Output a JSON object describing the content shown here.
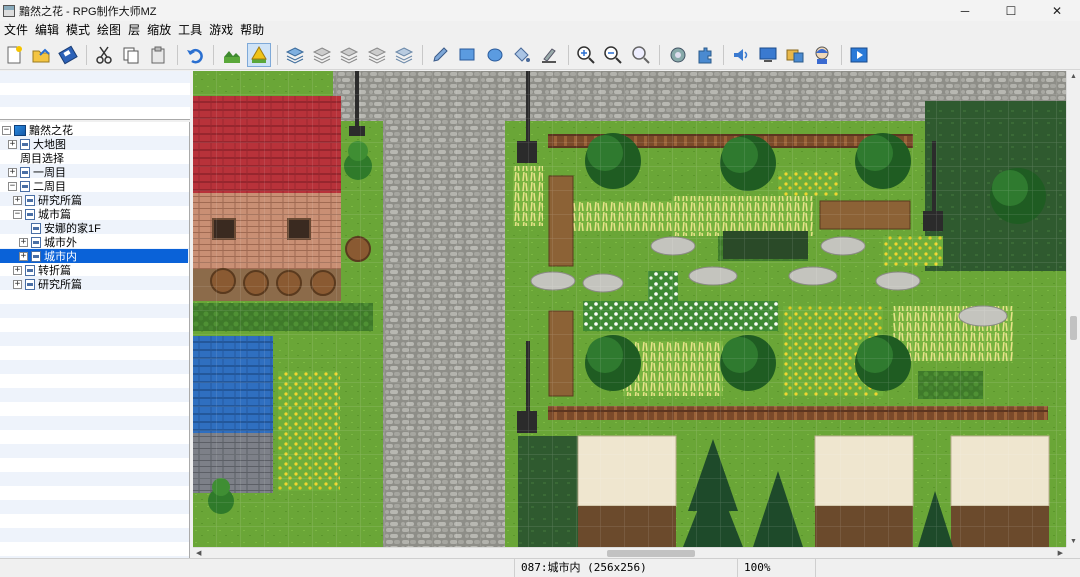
{
  "window": {
    "title": "黯然之花 - RPG制作大师MZ",
    "controls": [
      "─",
      "☐",
      "✕"
    ]
  },
  "menu": [
    "文件",
    "编辑",
    "模式",
    "绘图",
    "层",
    "缩放",
    "工具",
    "游戏",
    "帮助"
  ],
  "toolbar": {
    "buttons": [
      {
        "name": "new-project-icon"
      },
      {
        "name": "open-project-icon"
      },
      {
        "name": "save-project-icon"
      },
      {
        "name": "cut-icon"
      },
      {
        "name": "copy-icon"
      },
      {
        "name": "paste-icon"
      },
      {
        "name": "undo-icon"
      },
      {
        "name": "map-mode-icon"
      },
      {
        "name": "event-mode-icon",
        "active": true
      },
      {
        "name": "layer-auto-icon"
      },
      {
        "name": "layer-1-icon"
      },
      {
        "name": "layer-2-icon"
      },
      {
        "name": "layer-3-icon"
      },
      {
        "name": "layer-4-icon"
      },
      {
        "name": "pencil-icon"
      },
      {
        "name": "rectangle-icon"
      },
      {
        "name": "ellipse-icon"
      },
      {
        "name": "fill-icon"
      },
      {
        "name": "shadow-pen-icon"
      },
      {
        "name": "zoom-in-icon"
      },
      {
        "name": "zoom-out-icon"
      },
      {
        "name": "zoom-actual-icon"
      },
      {
        "name": "database-icon"
      },
      {
        "name": "plugin-manager-icon"
      },
      {
        "name": "sound-test-icon"
      },
      {
        "name": "event-searcher-icon"
      },
      {
        "name": "resource-manager-icon"
      },
      {
        "name": "character-generator-icon"
      },
      {
        "name": "playtest-icon"
      }
    ]
  },
  "tree": [
    {
      "label": "黯然之花",
      "level": 0,
      "expander": "−",
      "icon": "project",
      "selected": false
    },
    {
      "label": "大地图",
      "level": 1,
      "expander": "+",
      "icon": "map",
      "selected": false
    },
    {
      "label": "周目选择",
      "level": 1,
      "expander": "",
      "icon": "none",
      "selected": false
    },
    {
      "label": "一周目",
      "level": 1,
      "expander": "+",
      "icon": "map",
      "selected": false
    },
    {
      "label": "二周目",
      "level": 1,
      "expander": "−",
      "icon": "map",
      "selected": false
    },
    {
      "label": "研究所篇",
      "level": 2,
      "expander": "+",
      "icon": "map",
      "selected": false
    },
    {
      "label": "城市篇",
      "level": 2,
      "expander": "−",
      "icon": "map",
      "selected": false
    },
    {
      "label": "安娜的家1F",
      "level": 3,
      "expander": "",
      "icon": "map",
      "selected": false
    },
    {
      "label": "城市外",
      "level": 3,
      "expander": "+",
      "icon": "map",
      "selected": false
    },
    {
      "label": "城市内",
      "level": 3,
      "expander": "+",
      "icon": "map",
      "selected": true
    },
    {
      "label": "转折篇",
      "level": 2,
      "expander": "+",
      "icon": "map",
      "selected": false
    },
    {
      "label": "研究所篇",
      "level": 2,
      "expander": "+",
      "icon": "map",
      "selected": false
    }
  ],
  "status": {
    "map_info": "087:城市内 (256x256)",
    "zoom": "100%"
  },
  "colors": {
    "selection": "#0a62d8",
    "grass": "#6aa637",
    "cobblestone": "#9a9a94",
    "roof_red": "#b8323a",
    "roof_blue": "#2f6fc0",
    "hedge": "#3f7a2a"
  }
}
